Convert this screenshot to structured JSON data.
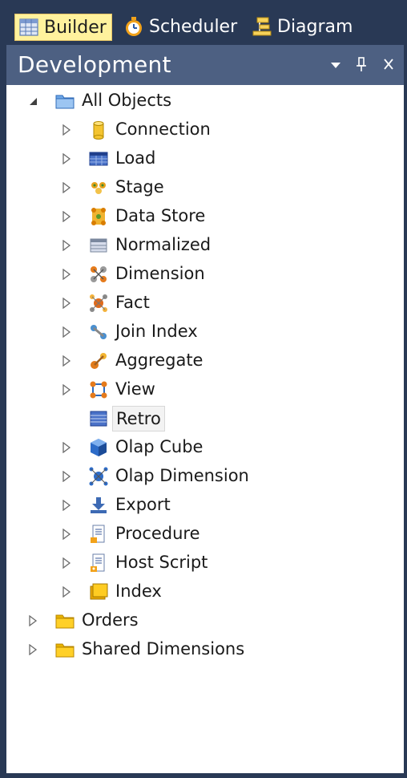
{
  "tabs": [
    {
      "label": "Builder",
      "icon": "grid-icon",
      "active": true
    },
    {
      "label": "Scheduler",
      "icon": "clock-icon",
      "active": false
    },
    {
      "label": "Diagram",
      "icon": "hierarchy-icon",
      "active": false
    }
  ],
  "panel": {
    "title": "Development",
    "dropdown_glyph": "▾",
    "pin_glyph": "ᅲ",
    "close_glyph": "✕"
  },
  "tree": {
    "root": {
      "label": "All Objects",
      "expanded": true,
      "icon": "folder-blue-icon"
    },
    "children": [
      {
        "label": "Connection",
        "icon": "cylinder-icon",
        "expandable": true
      },
      {
        "label": "Load",
        "icon": "table-blue-icon",
        "expandable": true
      },
      {
        "label": "Stage",
        "icon": "stage-icon",
        "expandable": true
      },
      {
        "label": "Data Store",
        "icon": "data-store-icon",
        "expandable": true
      },
      {
        "label": "Normalized",
        "icon": "normalized-table-icon",
        "expandable": true
      },
      {
        "label": "Dimension",
        "icon": "dimension-icon",
        "expandable": true
      },
      {
        "label": "Fact",
        "icon": "fact-icon",
        "expandable": true
      },
      {
        "label": "Join Index",
        "icon": "join-index-icon",
        "expandable": true
      },
      {
        "label": "Aggregate",
        "icon": "aggregate-icon",
        "expandable": true
      },
      {
        "label": "View",
        "icon": "view-icon",
        "expandable": true
      },
      {
        "label": "Retro",
        "icon": "retro-icon",
        "expandable": false,
        "selected": true
      },
      {
        "label": "Olap Cube",
        "icon": "cube-icon",
        "expandable": true
      },
      {
        "label": "Olap Dimension",
        "icon": "olap-dimension-icon",
        "expandable": true
      },
      {
        "label": "Export",
        "icon": "export-icon",
        "expandable": true
      },
      {
        "label": "Procedure",
        "icon": "procedure-icon",
        "expandable": true
      },
      {
        "label": "Host Script",
        "icon": "host-script-icon",
        "expandable": true
      },
      {
        "label": "Index",
        "icon": "index-icon",
        "expandable": true
      }
    ],
    "siblings": [
      {
        "label": "Orders",
        "icon": "folder-yellow-icon",
        "expandable": true
      },
      {
        "label": "Shared Dimensions",
        "icon": "folder-yellow-icon",
        "expandable": true
      }
    ]
  },
  "colors": {
    "chrome": "#293955",
    "panel_header": "#4d6082",
    "active_tab": "#fff29d",
    "text": "#1a1a1a"
  }
}
